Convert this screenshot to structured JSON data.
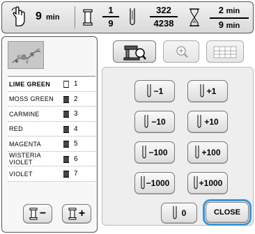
{
  "status": {
    "total_time_value": "9",
    "total_time_unit": "min",
    "color_current": "1",
    "color_total": "9",
    "stitch_current": "322",
    "stitch_total": "4238",
    "time_current_value": "2",
    "time_current_unit": "min",
    "time_total_value": "9",
    "time_total_unit": "min"
  },
  "colors": [
    {
      "name": "LIME GREEN",
      "index": "1",
      "selected": true
    },
    {
      "name": "MOSS GREEN",
      "index": "2"
    },
    {
      "name": "CARMINE",
      "index": "3"
    },
    {
      "name": "RED",
      "index": "4"
    },
    {
      "name": "MAGENTA",
      "index": "5"
    },
    {
      "name": "WISTERIA VIOLET",
      "index": "6"
    },
    {
      "name": "VIOLET",
      "index": "7"
    }
  ],
  "left_buttons": {
    "minus_label": "−",
    "plus_label": "+"
  },
  "stitch_buttons": {
    "minus1": "−1",
    "plus1": "+1",
    "minus10": "−10",
    "plus10": "+10",
    "minus100": "−100",
    "plus100": "+100",
    "minus1000": "−1000",
    "plus1000": "+1000",
    "zero": "0"
  },
  "close_label": "CLOSE",
  "accent": "#3a96d6"
}
